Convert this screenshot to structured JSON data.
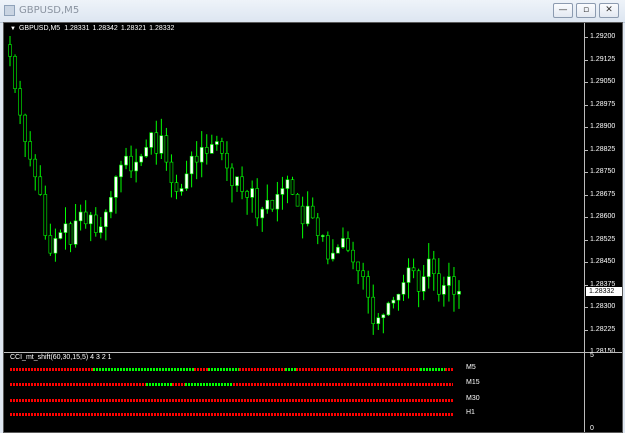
{
  "window": {
    "title": "GBPUSD,M5",
    "buttons": {
      "minimize": "—",
      "restore": "▫",
      "close": "✕"
    }
  },
  "chart": {
    "symbol": "GBPUSD,M5",
    "ohlc": {
      "open": "1.28331",
      "high": "1.28342",
      "low": "1.28321",
      "close": "1.28332"
    },
    "current_price": "1.28332",
    "price_ticks": [
      "1.29200",
      "1.29125",
      "1.29050",
      "1.28975",
      "1.28900",
      "1.28825",
      "1.28750",
      "1.28675",
      "1.28600",
      "1.28525",
      "1.28450",
      "1.28375",
      "1.28300",
      "1.28225",
      "1.28150"
    ],
    "colors": {
      "background": "#000000",
      "candle": "#00ff00",
      "candle_bull_body": "#ffffff",
      "axis_text": "#ffffff"
    }
  },
  "indicator": {
    "label": "CCI_mt_shift(60,30,15,5) 4 3 2 1",
    "axis_max": "5",
    "axis_min": "0",
    "colors": {
      "bear": "#ff0000",
      "bull": "#00ff00"
    },
    "rows": [
      {
        "label": "M5",
        "segments": [
          [
            "r",
            0.188
          ],
          [
            "g",
            0.228
          ],
          [
            "r",
            0.03
          ],
          [
            "g",
            0.07
          ],
          [
            "r",
            0.105
          ],
          [
            "g",
            0.025
          ],
          [
            "r",
            0.28
          ],
          [
            "g",
            0.055
          ],
          [
            "r",
            0.019
          ]
        ]
      },
      {
        "label": "M15",
        "segments": [
          [
            "r",
            0.306
          ],
          [
            "g",
            0.06
          ],
          [
            "r",
            0.03
          ],
          [
            "g",
            0.108
          ],
          [
            "r",
            0.496
          ]
        ]
      },
      {
        "label": "M30",
        "segments": [
          [
            "r",
            1.0
          ]
        ]
      },
      {
        "label": "H1",
        "segments": [
          [
            "r",
            1.0
          ]
        ]
      }
    ]
  },
  "chart_data": {
    "type": "candlestick",
    "title": "GBPUSD,M5",
    "ylim": [
      1.2812,
      1.2923
    ],
    "closes": [
      1.2913,
      1.2902,
      1.2893,
      1.2884,
      1.2878,
      1.2872,
      1.2866,
      1.2852,
      1.2846,
      1.2851,
      1.2853,
      1.2856,
      1.2849,
      1.2857,
      1.286,
      1.2856,
      1.2859,
      1.2853,
      1.2855,
      1.286,
      1.2865,
      1.2872,
      1.2876,
      1.2879,
      1.2874,
      1.2877,
      1.2879,
      1.2882,
      1.2887,
      1.288,
      1.2886,
      1.2877,
      1.287,
      1.2867,
      1.2868,
      1.2873,
      1.2879,
      1.2877,
      1.2882,
      1.288,
      1.2883,
      1.2884,
      1.288,
      1.2875,
      1.2869,
      1.2872,
      1.2867,
      1.2865,
      1.2868,
      1.2858,
      1.2861,
      1.2864,
      1.2861,
      1.2866,
      1.2868,
      1.2871,
      1.2866,
      1.2862,
      1.2856,
      1.2862,
      1.2858,
      1.2852,
      1.2852,
      1.2844,
      1.2846,
      1.2848,
      1.2851,
      1.2847,
      1.2843,
      1.284,
      1.2838,
      1.2831,
      1.2822,
      1.2824,
      1.2825,
      1.2829,
      1.283,
      1.2832,
      1.2836,
      1.2841,
      1.284,
      1.2833,
      1.2838,
      1.2844,
      1.2839,
      1.2832,
      1.2835,
      1.2838,
      1.2832,
      1.2833
    ]
  }
}
